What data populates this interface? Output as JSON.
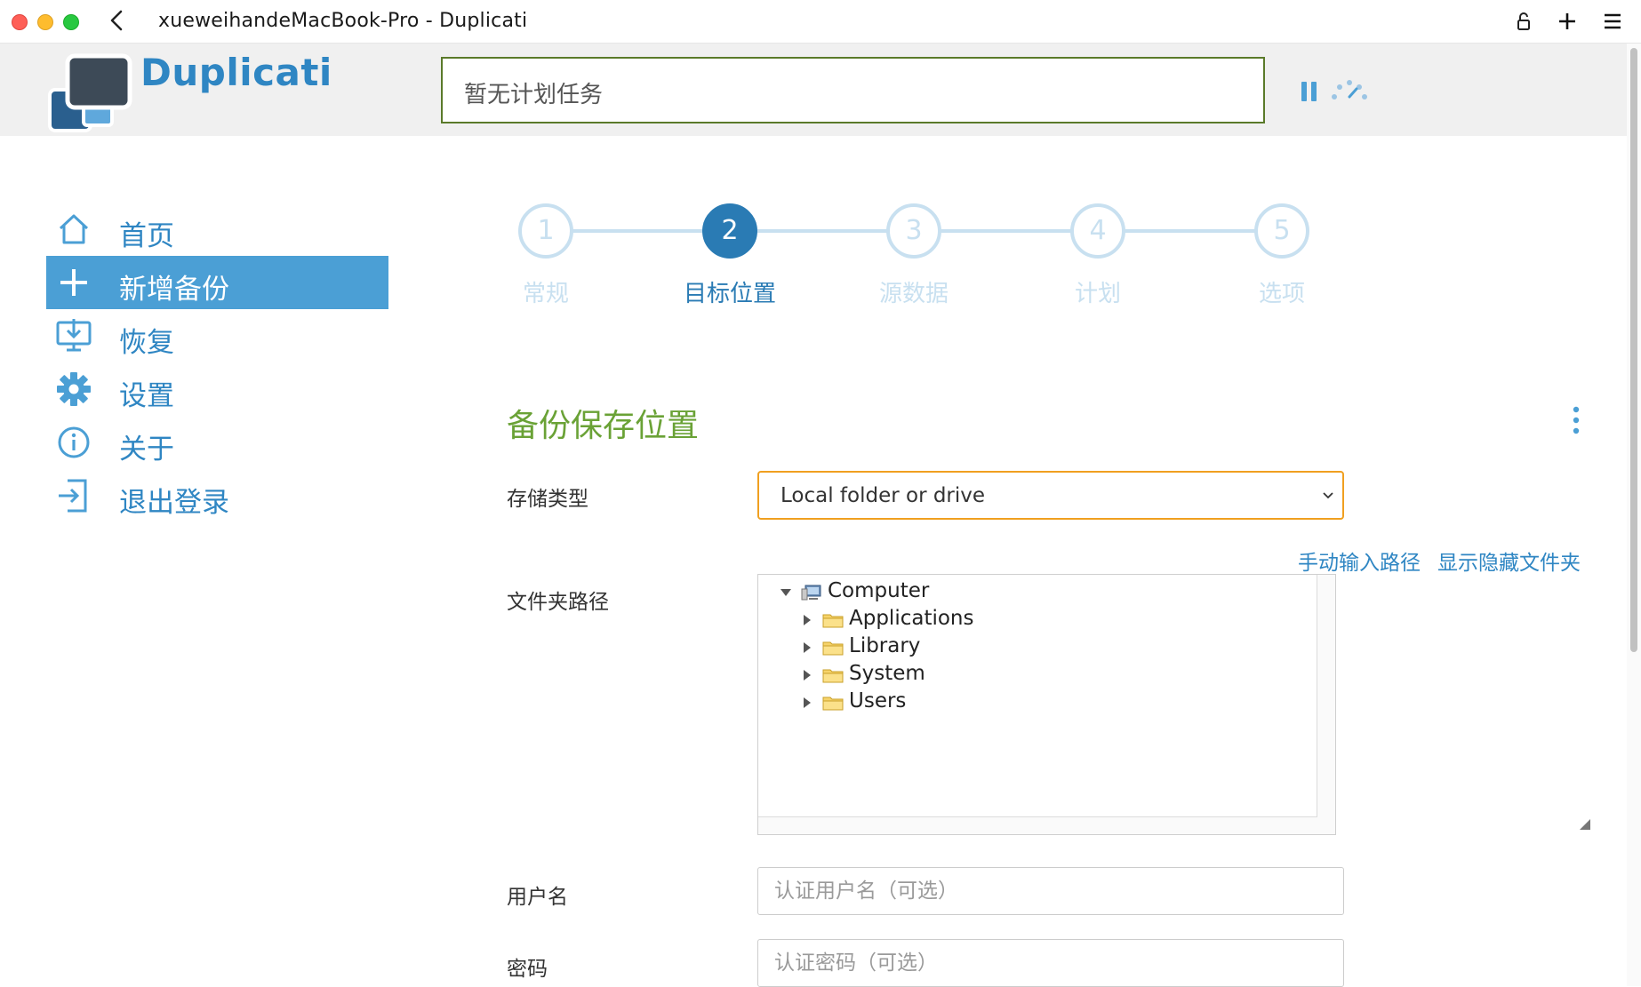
{
  "window": {
    "title": "xueweihandeMacBook-Pro - Duplicati"
  },
  "header": {
    "brand": "Duplicati",
    "status_text": "暂无计划任务"
  },
  "sidebar": {
    "items": [
      {
        "label": "首页",
        "icon": "home-icon",
        "active": false
      },
      {
        "label": "新增备份",
        "icon": "plus-icon",
        "active": true
      },
      {
        "label": "恢复",
        "icon": "restore-icon",
        "active": false
      },
      {
        "label": "设置",
        "icon": "gear-icon",
        "active": false
      },
      {
        "label": "关于",
        "icon": "info-icon",
        "active": false
      },
      {
        "label": "退出登录",
        "icon": "logout-icon",
        "active": false
      }
    ]
  },
  "wizard": {
    "current_step": 2,
    "steps": [
      {
        "number": "1",
        "label": "常规"
      },
      {
        "number": "2",
        "label": "目标位置"
      },
      {
        "number": "3",
        "label": "源数据"
      },
      {
        "number": "4",
        "label": "计划"
      },
      {
        "number": "5",
        "label": "选项"
      }
    ]
  },
  "form": {
    "section_title": "备份保存位置",
    "storage_type_label": "存储类型",
    "storage_type_value": "Local folder or drive",
    "manual_path_link": "手动输入路径",
    "show_hidden_link": "显示隐藏文件夹",
    "folder_path_label": "文件夹路径",
    "tree": {
      "root": "Computer",
      "children": [
        "Applications",
        "Library",
        "System",
        "Users"
      ]
    },
    "username_label": "用户名",
    "username_placeholder": "认证用户名（可选）",
    "password_label": "密码",
    "password_placeholder": "认证密码（可选）"
  },
  "colors": {
    "brand_blue": "#2f86c3",
    "active_nav": "#4b9fd5",
    "step_active": "#2a7bb4",
    "step_inactive": "#c8e0f0",
    "section_green": "#6aa236",
    "select_focus": "#f0a020"
  }
}
